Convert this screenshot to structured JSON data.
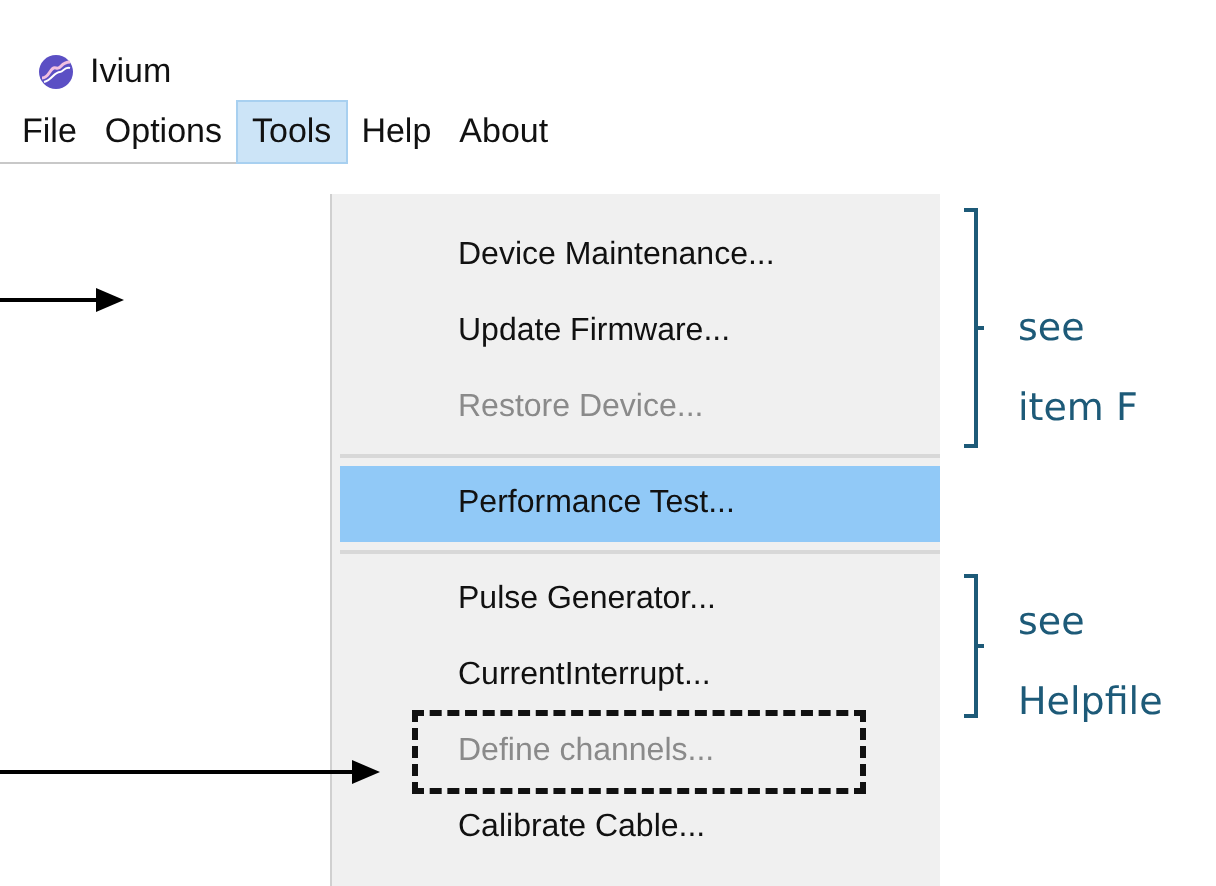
{
  "window": {
    "title": "Ivium"
  },
  "menu_bar": [
    {
      "label": "File",
      "selected": false
    },
    {
      "label": "Options",
      "selected": false
    },
    {
      "label": "Tools",
      "selected": true
    },
    {
      "label": "Help",
      "selected": false
    },
    {
      "label": "About",
      "selected": false
    }
  ],
  "menu": {
    "groups": [
      [
        {
          "label": "Device Maintenance...",
          "disabled": false,
          "selected": false,
          "outlined": false
        },
        {
          "label": "Update Firmware...",
          "disabled": false,
          "selected": false,
          "outlined": false
        },
        {
          "label": "Restore Device...",
          "disabled": true,
          "selected": false,
          "outlined": false
        }
      ],
      [
        {
          "label": "Performance Test...",
          "disabled": false,
          "selected": true,
          "outlined": false
        }
      ],
      [
        {
          "label": "Pulse Generator...",
          "disabled": false,
          "selected": false,
          "outlined": false
        },
        {
          "label": "CurrentInterrupt...",
          "disabled": false,
          "selected": false,
          "outlined": false
        },
        {
          "label": "Define channels...",
          "disabled": true,
          "selected": false,
          "outlined": true
        },
        {
          "label": "Calibrate Cable...",
          "disabled": false,
          "selected": false,
          "outlined": false
        }
      ]
    ]
  },
  "notes": [
    {
      "lines": [
        "see",
        "item F"
      ]
    },
    {
      "lines": [
        "see",
        "Helpfile"
      ]
    }
  ]
}
